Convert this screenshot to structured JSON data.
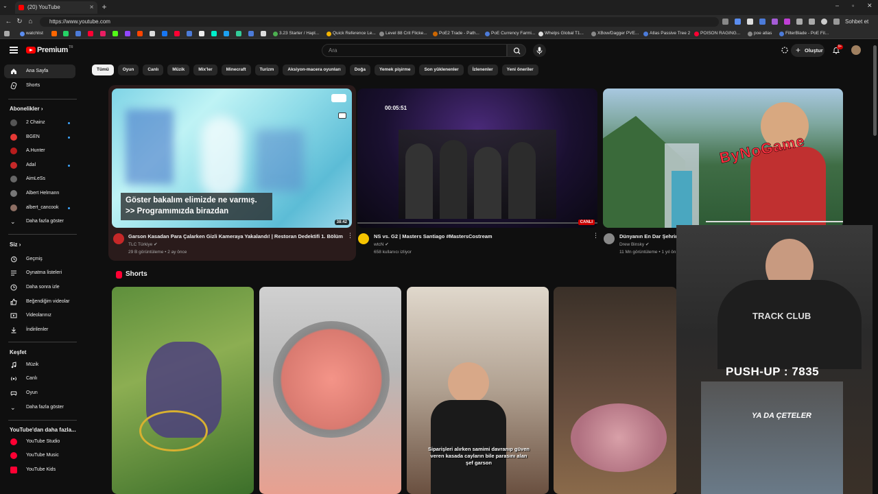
{
  "browser": {
    "tab_title": "(20) YouTube",
    "url": "https://www.youtube.com",
    "profile_btn": "Sohbet et",
    "bookmarks": [
      "watchlist",
      "3.23 Starter / Hapl...",
      "Quick Reference Le...",
      "Level 88 Crit Flicke...",
      "PoE2 Trade - Path...",
      "PoE Currency Farmi...",
      "Whelps Global T1...",
      "XBow/Dagger PVE...",
      "Atlas Passive Tree 2",
      "POISON RAGING...",
      "poe atlas",
      "FilterBlade - PoE Fil..."
    ]
  },
  "header": {
    "logo_text": "Premium",
    "logo_region": "TR",
    "search_placeholder": "Ara",
    "create_label": "Oluştur",
    "notif_count": "9+"
  },
  "sidebar": {
    "main": [
      {
        "label": "Ana Sayfa",
        "icon": "home-icon"
      },
      {
        "label": "Shorts",
        "icon": "shorts-icon"
      }
    ],
    "subs_heading": "Abonelikler",
    "subs": [
      {
        "label": "2 Chainz",
        "color": "#555555",
        "dot": true
      },
      {
        "label": "BGEN",
        "color": "#e53935",
        "dot": true
      },
      {
        "label": "A.Hunter",
        "color": "#b71c1c",
        "dot": false
      },
      {
        "label": "Adal",
        "color": "#c62828",
        "dot": true
      },
      {
        "label": "AimLeSs",
        "color": "#666666",
        "dot": false
      },
      {
        "label": "Albert Helmann",
        "color": "#777777",
        "dot": false
      },
      {
        "label": "albert_cancook",
        "color": "#8d6e63",
        "dot": true
      }
    ],
    "subs_more": "Daha fazla göster",
    "you_heading": "Siz",
    "you": [
      {
        "label": "Geçmiş",
        "icon": "history-icon"
      },
      {
        "label": "Oynatma listeleri",
        "icon": "playlist-icon"
      },
      {
        "label": "Daha sonra izle",
        "icon": "watch-later-icon"
      },
      {
        "label": "Beğendiğim videolar",
        "icon": "like-icon"
      },
      {
        "label": "Videolarınız",
        "icon": "your-videos-icon"
      },
      {
        "label": "İndirilenler",
        "icon": "download-icon"
      }
    ],
    "explore_heading": "Keşfet",
    "explore": [
      {
        "label": "Müzik",
        "icon": "music-icon"
      },
      {
        "label": "Canlı",
        "icon": "live-icon"
      },
      {
        "label": "Oyun",
        "icon": "gaming-icon"
      }
    ],
    "explore_more": "Daha fazla göster",
    "more_heading": "YouTube'dan daha fazla...",
    "more": [
      {
        "label": "YouTube Studio"
      },
      {
        "label": "YouTube Music"
      },
      {
        "label": "YouTube Kids"
      }
    ]
  },
  "chips": [
    "Tümü",
    "Oyun",
    "Canlı",
    "Müzik",
    "Mix'ler",
    "Minecraft",
    "Turizm",
    "Aksiyon-macera oyunları",
    "Doğa",
    "Yemek pişirme",
    "Son yüklenenler",
    "İzlenenler",
    "Yeni öneriler"
  ],
  "videos": [
    {
      "title": "Garson Kasadan Para Çalarken Gizli Kameraya Yakalandı! | Restoran Dedektifi 1. Bölüm",
      "channel": "TLC Türkiye",
      "meta": "29 B görüntüleme • 2 ay önce",
      "duration": "38:42",
      "caption": "Göster bakalım elimizde ne varmış. >> Programımızda birazdan"
    },
    {
      "title": "NS vs. G2 | Masters Santiago #MastersCostream",
      "channel": "wtcN",
      "meta": "658 kullanıcı izliyor",
      "live": "CANLI",
      "timer": "00:05:51"
    },
    {
      "title": "Dünyanın En Dar Şehrinde",
      "channel": "Drew Binsky",
      "meta": "11 Mn görüntüleme • 1 yıl önce",
      "overlay": "ByNoGame"
    }
  ],
  "shorts_heading": "Shorts",
  "shorts_captions": [
    "Siparişleri alırken samimi davranıp güven veren kasada cayların bile parasını alan şef garson",
    "YA DA ÇETELER"
  ],
  "stream_overlay": {
    "pushup": "PUSH-UP : 7835",
    "shirt": "TRACK CLUB"
  }
}
